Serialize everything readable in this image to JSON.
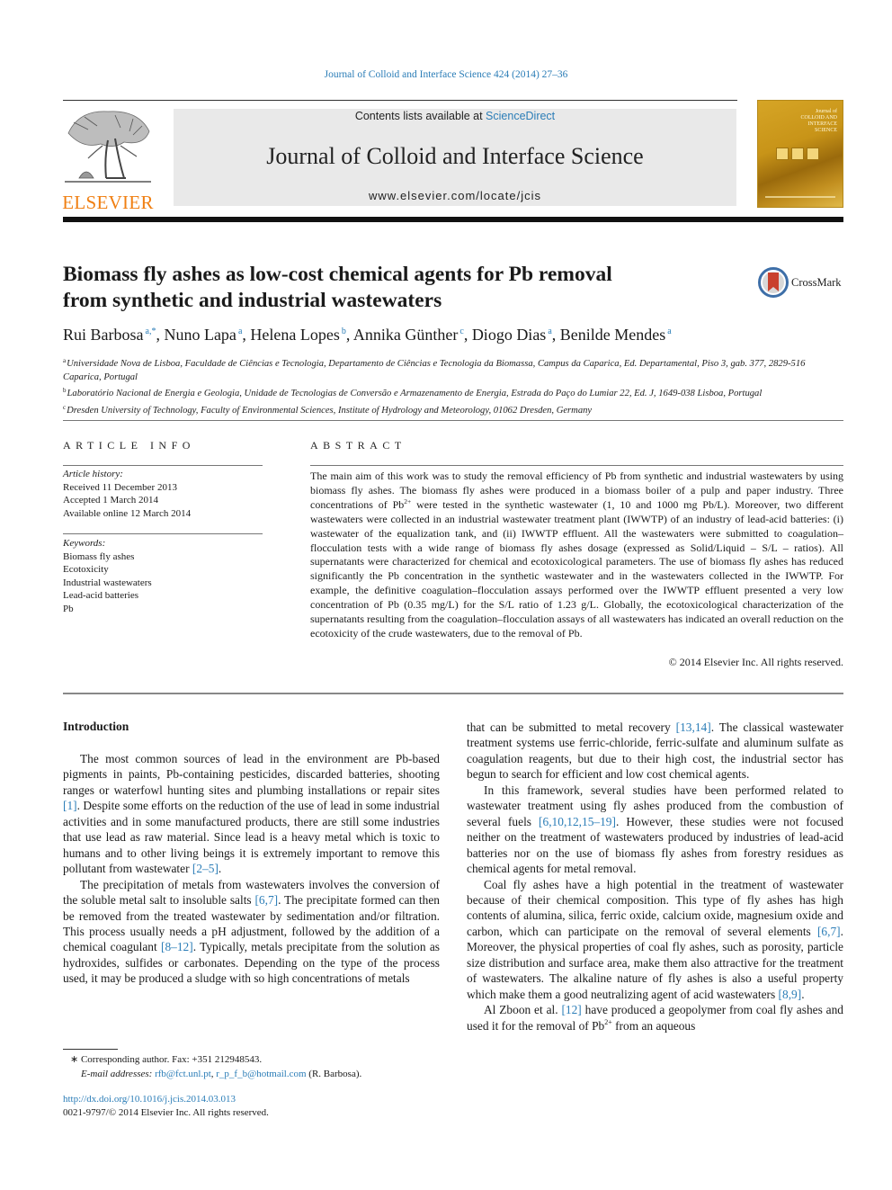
{
  "running_head": "Journal of Colloid and Interface Science 424 (2014) 27–36",
  "publisher": {
    "wordmark": "ELSEVIER",
    "brand_color": "#f07f12",
    "logo_icon": "elsevier-tree-icon"
  },
  "masthead": {
    "contents_prefix": "Contents lists available at ",
    "contents_link": "ScienceDirect",
    "journal_name": "Journal of Colloid and Interface Science",
    "journal_url": "www.elsevier.com/locate/jcis",
    "background": "#e9e9e9"
  },
  "cover": {
    "title_lines": [
      "Journal of",
      "COLLOID AND",
      "INTERFACE",
      "SCIENCE"
    ],
    "color": "#c89418"
  },
  "crossmark": {
    "label": "CrossMark"
  },
  "article": {
    "title_line1": "Biomass fly ashes as low-cost chemical agents for Pb removal",
    "title_line2": "from synthetic and industrial wastewaters",
    "authors": [
      {
        "name": "Rui Barbosa",
        "marks": "a,*"
      },
      {
        "name": "Nuno Lapa",
        "marks": "a"
      },
      {
        "name": "Helena Lopes",
        "marks": "b"
      },
      {
        "name": "Annika Günther",
        "marks": "c"
      },
      {
        "name": "Diogo Dias",
        "marks": "a"
      },
      {
        "name": "Benilde Mendes",
        "marks": "a"
      }
    ],
    "affiliations": [
      {
        "mark": "a",
        "text": "Universidade Nova de Lisboa, Faculdade de Ciências e Tecnologia, Departamento de Ciências e Tecnologia da Biomassa, Campus da Caparica, Ed. Departamental, Piso 3, gab. 377, 2829-516 Caparica, Portugal"
      },
      {
        "mark": "b",
        "text": "Laboratório Nacional de Energia e Geologia, Unidade de Tecnologias de Conversão e Armazenamento de Energia, Estrada do Paço do Lumiar 22, Ed. J, 1649-038 Lisboa, Portugal"
      },
      {
        "mark": "c",
        "text": "Dresden University of Technology, Faculty of Environmental Sciences, Institute of Hydrology and Meteorology, 01062 Dresden, Germany"
      }
    ]
  },
  "article_info": {
    "heading": "ARTICLE INFO",
    "history_label": "Article history:",
    "history": [
      "Received 11 December 2013",
      "Accepted 1 March 2014",
      "Available online 12 March 2014"
    ],
    "keywords_label": "Keywords:",
    "keywords": [
      "Biomass fly ashes",
      "Ecotoxicity",
      "Industrial wastewaters",
      "Lead-acid batteries",
      "Pb"
    ]
  },
  "abstract": {
    "heading": "ABSTRACT",
    "part1": "The main aim of this work was to study the removal efficiency of Pb from synthetic and industrial wastewaters by using biomass fly ashes. The biomass fly ashes were produced in a biomass boiler of a pulp and paper industry. Three concentrations of Pb",
    "sup1": "2+",
    "part2": " were tested in the synthetic wastewater (1, 10 and 1000 mg Pb/L). Moreover, two different wastewaters were collected in an industrial wastewater treatment plant (IWWTP) of an industry of lead-acid batteries: (i) wastewater of the equalization tank, and (ii) IWWTP effluent. All the wastewaters were submitted to coagulation–flocculation tests with a wide range of biomass fly ashes dosage (expressed as Solid/Liquid – S/L – ratios). All supernatants were characterized for chemical and ecotoxicological parameters. The use of biomass fly ashes has reduced significantly the Pb concentration in the synthetic wastewater and in the wastewaters collected in the IWWTP. For example, the definitive coagulation–flocculation assays performed over the IWWTP effluent presented a very low concentration of Pb (0.35 mg/L) for the S/L ratio of 1.23 g/L. Globally, the ecotoxicological characterization of the supernatants resulting from the coagulation–flocculation assays of all wastewaters has indicated an overall reduction on the ecotoxicity of the crude wastewaters, due to the removal of Pb.",
    "copyright": "© 2014 Elsevier Inc. All rights reserved."
  },
  "body": {
    "intro_heading": "Introduction",
    "left": {
      "p1": [
        "The most common sources of lead in the environment are Pb-based pigments in paints, Pb-containing pesticides, discarded batteries, shooting ranges or waterfowl hunting sites and plumbing installations or repair sites ",
        "[1]",
        ". Despite some efforts on the reduction of the use of lead in some industrial activities and in some manufactured products, there are still some industries that use lead as raw material. Since lead is a heavy metal which is toxic to humans and to other living beings it is extremely important to remove this pollutant from wastewater ",
        "[2–5]",
        "."
      ],
      "p2": [
        "The precipitation of metals from wastewaters involves the conversion of the soluble metal salt to insoluble salts ",
        "[6,7]",
        ". The precipitate formed can then be removed from the treated wastewater by sedimentation and/or filtration. This process usually needs a pH adjustment, followed by the addition of a chemical coagulant ",
        "[8–12]",
        ". Typically, metals precipitate from the solution as hydroxides, sulfides or carbonates. Depending on the type of the process used, it may be produced a sludge with so high concentrations of metals"
      ]
    },
    "right": {
      "p1": [
        "that can be submitted to metal recovery ",
        "[13,14]",
        ". The classical wastewater treatment systems use ferric-chloride, ferric-sulfate and aluminum sulfate as coagulation reagents, but due to their high cost, the industrial sector has begun to search for efficient and low cost chemical agents."
      ],
      "p2": [
        "In this framework, several studies have been performed related to wastewater treatment using fly ashes produced from the combustion of several fuels ",
        "[6,10,12,15–19]",
        ". However, these studies were not focused neither on the treatment of wastewaters produced by industries of lead-acid batteries nor on the use of biomass fly ashes from forestry residues as chemical agents for metal removal."
      ],
      "p3": [
        "Coal fly ashes have a high potential in the treatment of wastewater because of their chemical composition. This type of fly ashes has high contents of alumina, silica, ferric oxide, calcium oxide, magnesium oxide and carbon, which can participate on the removal of several elements ",
        "[6,7]",
        ". Moreover, the physical properties of coal fly ashes, such as porosity, particle size distribution and surface area, make them also attractive for the treatment of wastewaters. The alkaline nature of fly ashes is also a useful property which make them a good neutralizing agent of acid wastewaters ",
        "[8,9]",
        "."
      ],
      "p4": [
        "Al Zboon et al. ",
        "[12]",
        " have produced a geopolymer from coal fly ashes and used it for the removal of Pb",
        "2+",
        " from an aqueous"
      ]
    }
  },
  "footnotes": {
    "corresponding": "∗ Corresponding author. Fax: +351 212948543.",
    "email_label": "E-mail addresses: ",
    "email1": "rfb@fct.unl.pt",
    "email_sep": ", ",
    "email2": "r_p_f_b@hotmail.com",
    "email_suffix": " (R. Barbosa).",
    "doi": "http://dx.doi.org/10.1016/j.jcis.2014.03.013",
    "issn": "0021-9797/© 2014 Elsevier Inc. All rights reserved."
  },
  "colors": {
    "link": "#2b7db7",
    "text": "#1a1a1a"
  }
}
